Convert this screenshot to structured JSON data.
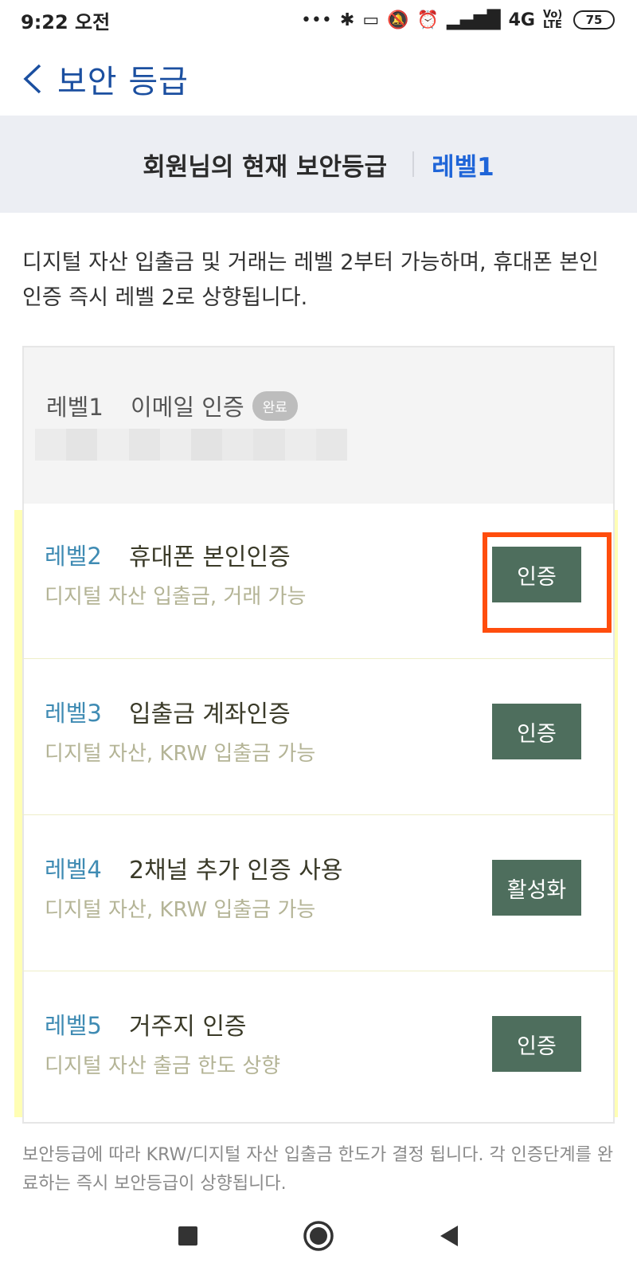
{
  "status_bar": {
    "time": "9:22 오전",
    "signal": "4G",
    "volte": "Vo) LTE",
    "battery": "75"
  },
  "header": {
    "title": "보안 등급"
  },
  "banner": {
    "label": "회원님의 현재 보안등급",
    "current_level": "레벨1"
  },
  "description": "디지털 자산 입출금 및 거래는 레벨 2부터 가능하며, 휴대폰 본인 인증 즉시 레벨 2로 상향됩니다.",
  "level1": {
    "level": "레벨1",
    "title": "이메일 인증",
    "badge": "완료"
  },
  "levels": [
    {
      "level": "레벨2",
      "title": "휴대폰 본인인증",
      "desc": "디지털 자산 입출금, 거래 가능",
      "button": "인증"
    },
    {
      "level": "레벨3",
      "title": "입출금 계좌인증",
      "desc": "디지털 자산, KRW 입출금 가능",
      "button": "인증"
    },
    {
      "level": "레벨4",
      "title": "2채널 추가 인증 사용",
      "desc": "디지털 자산, KRW 입출금 가능",
      "button": "활성화"
    },
    {
      "level": "레벨5",
      "title": "거주지 인증",
      "desc": "디지털 자산 출금 한도 상향",
      "button": "인증"
    }
  ],
  "footer_note": "보안등급에 따라 KRW/디지털 자산 입출금 한도가 결정 됩니다. 각 인증단계를 완료하는 즉시 보안등급이 상향됩니다.",
  "colors": {
    "accent": "#1f65d8",
    "button": "#4e6e5d",
    "highlight": "#fffeb4",
    "annotation": "#ff4d0d"
  }
}
